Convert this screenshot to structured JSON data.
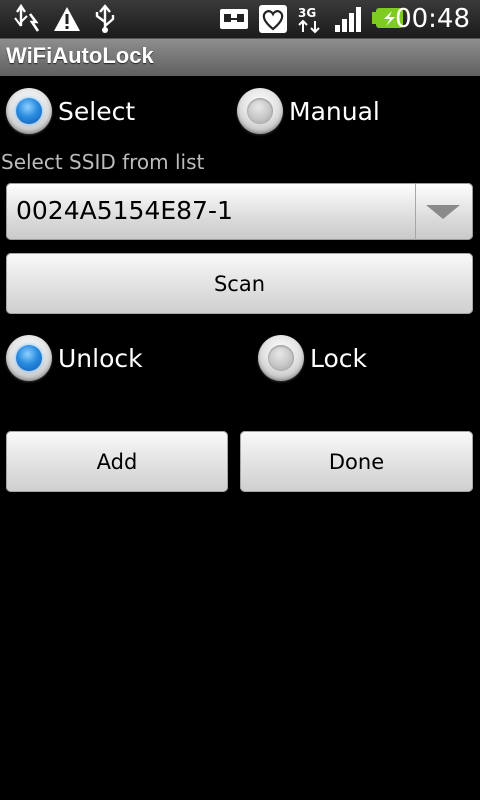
{
  "status_bar": {
    "icons": [
      "usb-debug-icon",
      "warning-icon",
      "usb-icon",
      "sdcard-icon",
      "heart-icon",
      "3g-data-icon",
      "signal-icon",
      "battery-charging-icon"
    ],
    "network_type": "3G",
    "time": "00:48"
  },
  "app": {
    "title": "WiFiAutoLock"
  },
  "mode": {
    "select_label": "Select",
    "manual_label": "Manual",
    "selected": "Select"
  },
  "ssid": {
    "label": "Select SSID from list",
    "selected_value": "0024A5154E87-1"
  },
  "buttons": {
    "scan": "Scan",
    "add": "Add",
    "done": "Done"
  },
  "action": {
    "unlock_label": "Unlock",
    "lock_label": "Lock",
    "selected": "Unlock"
  },
  "colors": {
    "accent_radio": "#2a8ce0",
    "background": "#000000",
    "title_bar": "#7a7a7a"
  }
}
